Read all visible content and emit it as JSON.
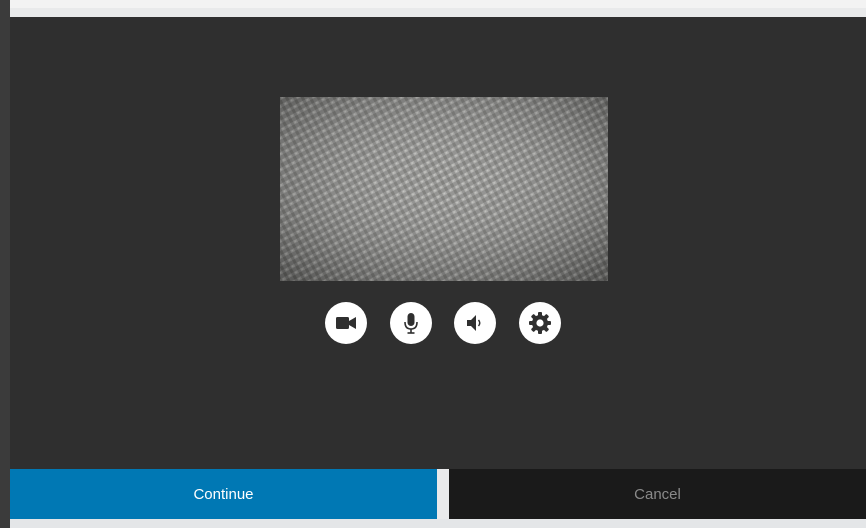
{
  "preview": {
    "icon": "camera-preview-image"
  },
  "controls": {
    "camera": {
      "icon": "video-camera-icon"
    },
    "microphone": {
      "icon": "microphone-icon"
    },
    "speaker": {
      "icon": "speaker-icon"
    },
    "settings": {
      "icon": "gear-icon"
    }
  },
  "actions": {
    "continue_label": "Continue",
    "cancel_label": "Cancel"
  },
  "colors": {
    "panel": "#2f2f2f",
    "continue": "#0078b4",
    "cancel": "#1a1a1a"
  }
}
